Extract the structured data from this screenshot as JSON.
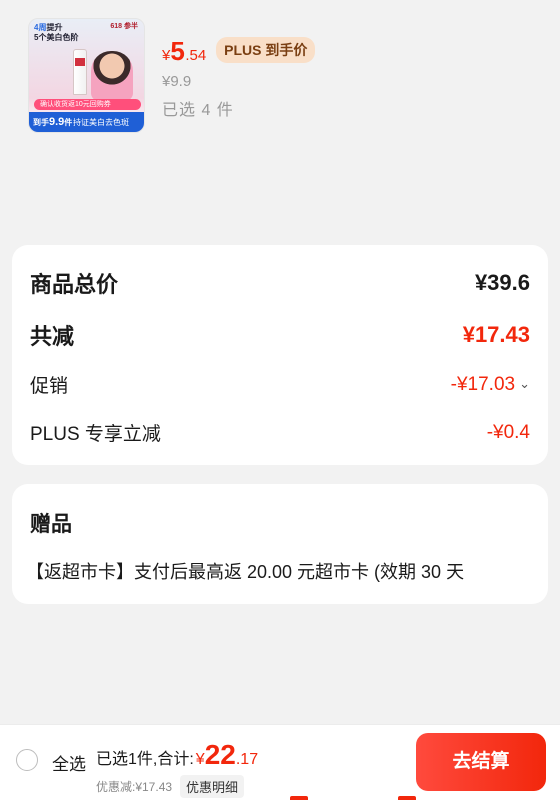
{
  "product": {
    "thumbnail": {
      "headline_blue": "4周",
      "headline_1": "提升",
      "headline_2": "5个美白色阶",
      "brand_1": "618",
      "brand_2": "参半",
      "banner": "确认收货返10元回购券",
      "price_prefix": "到手",
      "price": "9.9",
      "price_suffix": "件",
      "tagline": "持证美白去色斑"
    },
    "price_yen": "¥",
    "price_int": "5",
    "price_dec": ".54",
    "plus_badge": "PLUS 到手价",
    "original_price": "¥9.9",
    "selected_count": "已选 4 件"
  },
  "summary": {
    "total_label": "商品总价",
    "total_value": "¥39.6",
    "reduce_label": "共减",
    "reduce_value": "¥17.43",
    "promo_label": "促销",
    "promo_value": "-¥17.03",
    "plus_label": "PLUS 专享立减",
    "plus_value": "-¥0.4"
  },
  "gift": {
    "title": "赠品",
    "description": "【返超市卡】支付后最高返 20.00 元超市卡 (效期 30 天"
  },
  "bottom_bar": {
    "select_all": "全选",
    "selected_total_label": "已选1件,合计:",
    "total_yen": "¥",
    "total_int": "22",
    "total_dec": ".17",
    "discount_text": "优惠减:¥17.43",
    "discount_detail": "优惠明细",
    "checkout": "去结算"
  },
  "colors": {
    "accent_red": "#f2270c",
    "plus_badge_bg": "#f9dfc8",
    "page_bg": "#f2f2f2"
  }
}
